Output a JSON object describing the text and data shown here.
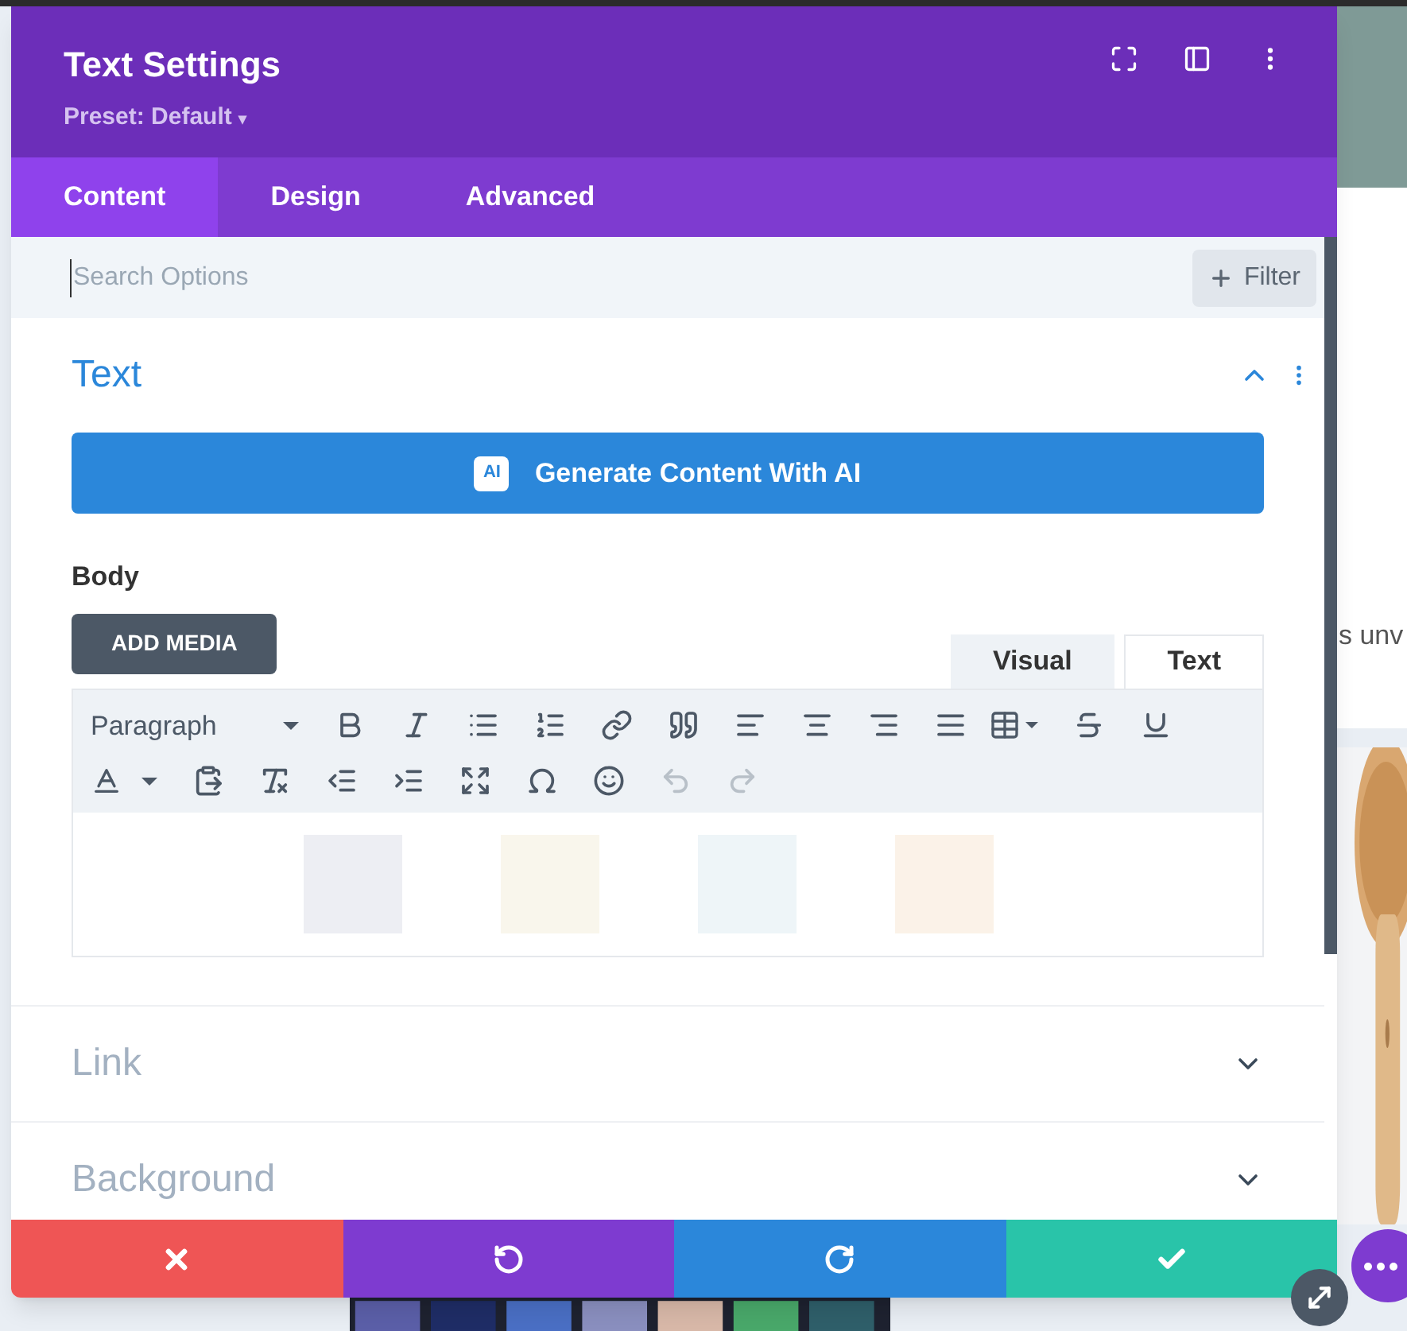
{
  "modal": {
    "title": "Text Settings",
    "preset": "Preset: Default",
    "preset_caret": "▾"
  },
  "tabs": [
    {
      "label": "Content",
      "selected": true
    },
    {
      "label": "Design",
      "selected": false
    },
    {
      "label": "Advanced",
      "selected": false
    }
  ],
  "search": {
    "placeholder": "Search Options",
    "filter_label": "Filter"
  },
  "sections": [
    {
      "title": "Text",
      "expanded": true
    },
    {
      "title": "Link",
      "expanded": false
    },
    {
      "title": "Background",
      "expanded": false
    }
  ],
  "text_section": {
    "ai_button": "Generate Content With AI",
    "ai_badge": "AI",
    "body_label": "Body",
    "add_media": "ADD MEDIA",
    "editor_tabs": [
      {
        "label": "Visual",
        "selected": true
      },
      {
        "label": "Text",
        "selected": false
      }
    ],
    "format_select": "Paragraph",
    "undo_disabled": true,
    "redo_disabled": true
  },
  "background_page": {
    "text_fragment": "s unv"
  }
}
